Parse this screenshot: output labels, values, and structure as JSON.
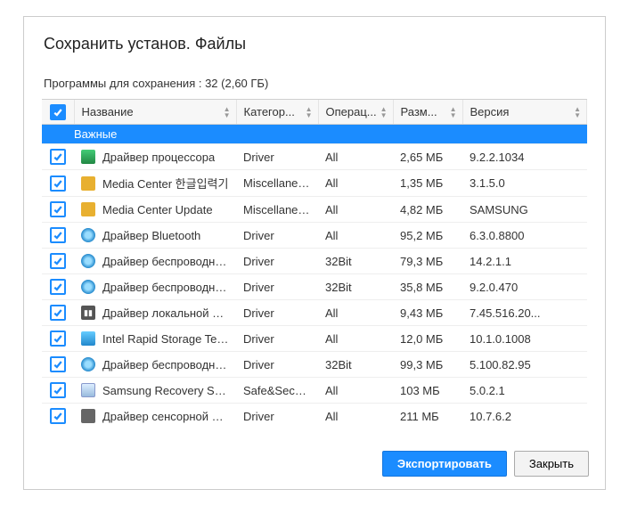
{
  "dialog": {
    "title": "Сохранить установ. Файлы",
    "subtitle": "Программы для сохранения : 32 (2,60 ГБ)"
  },
  "columns": {
    "name": "Название",
    "category": "Категор...",
    "os": "Операц...",
    "size": "Разм...",
    "version": "Версия"
  },
  "group": {
    "label": "Важные"
  },
  "rows": [
    {
      "checked": true,
      "icon": "ic-chip",
      "name": "Драйвер процессора",
      "category": "Driver",
      "os": "All",
      "size": "2,65 МБ",
      "version": "9.2.2.1034"
    },
    {
      "checked": true,
      "icon": "ic-media",
      "name": "Media  Center 한글입력기",
      "category": "Miscellaneous",
      "os": "All",
      "size": "1,35 МБ",
      "version": "3.1.5.0"
    },
    {
      "checked": true,
      "icon": "ic-media",
      "name": "Media Center Update",
      "category": "Miscellaneous",
      "os": "All",
      "size": "4,82 МБ",
      "version": "SAMSUNG"
    },
    {
      "checked": true,
      "icon": "ic-disc",
      "name": "Драйвер Bluetooth",
      "category": "Driver",
      "os": "All",
      "size": "95,2 МБ",
      "version": "6.3.0.8800"
    },
    {
      "checked": true,
      "icon": "ic-disc",
      "name": "Драйвер  беспроводной...",
      "category": "Driver",
      "os": "32Bit",
      "size": "79,3 МБ",
      "version": "14.2.1.1"
    },
    {
      "checked": true,
      "icon": "ic-disc",
      "name": "Драйвер  беспроводной...",
      "category": "Driver",
      "os": "32Bit",
      "size": "35,8 МБ",
      "version": "9.2.0.470"
    },
    {
      "checked": true,
      "icon": "ic-net",
      "name": "Драйвер локальной сети",
      "category": "Driver",
      "os": "All",
      "size": "9,43 МБ",
      "version": "7.45.516.20..."
    },
    {
      "checked": true,
      "icon": "ic-intel",
      "name": "Intel Rapid Storage Tech...",
      "category": "Driver",
      "os": "All",
      "size": "12,0 МБ",
      "version": "10.1.0.1008"
    },
    {
      "checked": true,
      "icon": "ic-disc",
      "name": "Драйвер  беспроводной...",
      "category": "Driver",
      "os": "32Bit",
      "size": "99,3 МБ",
      "version": "5.100.82.95"
    },
    {
      "checked": true,
      "icon": "ic-safe",
      "name": "Samsung Recovery Solut...",
      "category": "Safe&Security",
      "os": "All",
      "size": "103 МБ",
      "version": "5.0.2.1"
    },
    {
      "checked": true,
      "icon": "ic-touch",
      "name": "Драйвер сенсорной па...",
      "category": "Driver",
      "os": "All",
      "size": "211 МБ",
      "version": "10.7.6.2"
    }
  ],
  "footer": {
    "export": "Экспортировать",
    "close": "Закрыть"
  }
}
